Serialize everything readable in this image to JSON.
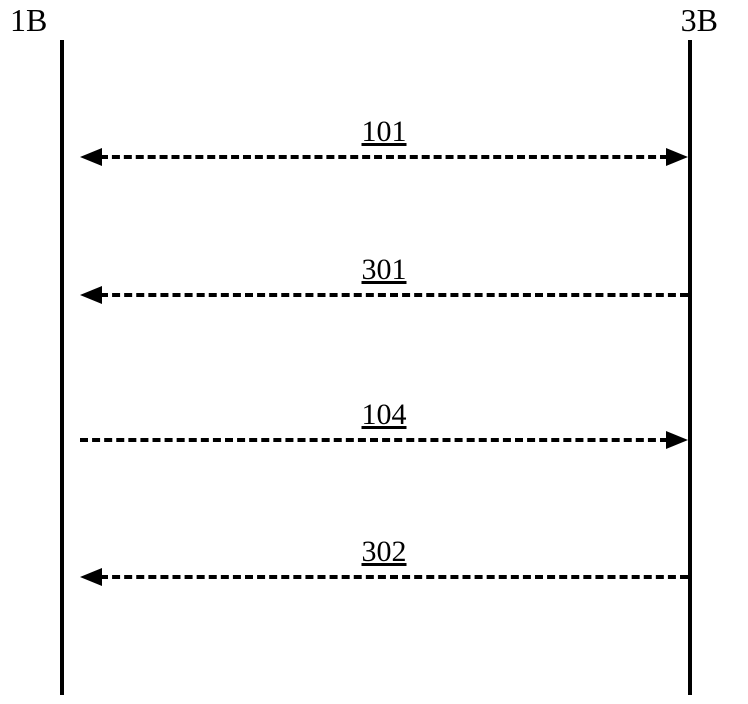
{
  "participants": {
    "left": {
      "label": "1B"
    },
    "right": {
      "label": "3B"
    }
  },
  "messages": [
    {
      "label": "101",
      "direction": "both"
    },
    {
      "label": "301",
      "direction": "left"
    },
    {
      "label": "104",
      "direction": "right"
    },
    {
      "label": "302",
      "direction": "left"
    }
  ]
}
